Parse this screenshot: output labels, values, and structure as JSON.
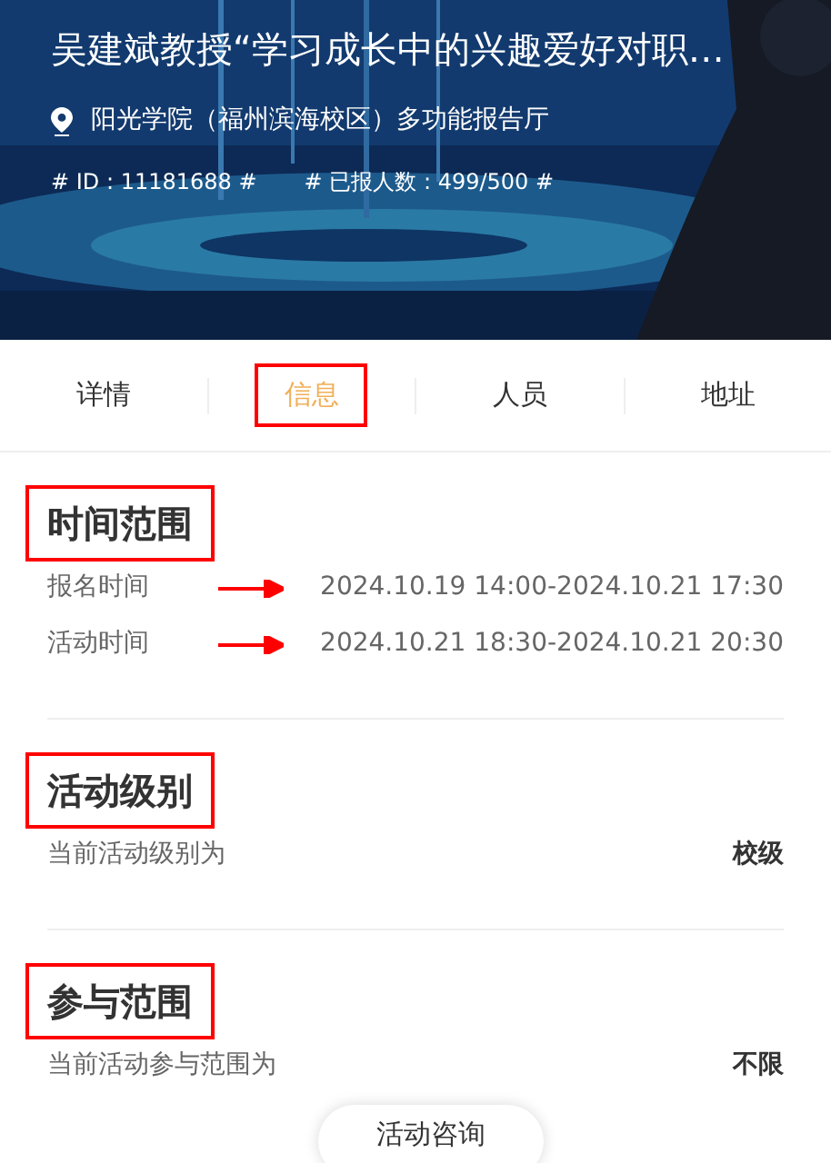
{
  "header": {
    "title": "吴建斌教授“学习成长中的兴趣爱好对职…",
    "location": "阳光学院（福州滨海校区）多功能报告厅",
    "id_tag": "# ID : 11181688 #",
    "count_tag": "# 已报人数 : 499/500 #"
  },
  "tabs": [
    {
      "label": "详情",
      "selected": false,
      "annotated": false
    },
    {
      "label": "信息",
      "selected": true,
      "annotated": true
    },
    {
      "label": "人员",
      "selected": false,
      "annotated": false
    },
    {
      "label": "地址",
      "selected": false,
      "annotated": false
    }
  ],
  "sections": [
    {
      "title": "时间范围",
      "annotated": true,
      "rows": [
        {
          "label": "报名时间",
          "value": "2024.10.19 14:00-2024.10.21 17:30",
          "arrow": true,
          "bold": false
        },
        {
          "label": "活动时间",
          "value": "2024.10.21 18:30-2024.10.21 20:30",
          "arrow": true,
          "bold": false
        }
      ]
    },
    {
      "title": "活动级别",
      "annotated": true,
      "rows": [
        {
          "label": "当前活动级别为",
          "value": "校级",
          "arrow": false,
          "bold": true
        }
      ]
    },
    {
      "title": "参与范围",
      "annotated": true,
      "rows": [
        {
          "label": "当前活动参与范围为",
          "value": "不限",
          "arrow": false,
          "bold": true
        }
      ]
    }
  ],
  "consult_button": "活动咨询"
}
